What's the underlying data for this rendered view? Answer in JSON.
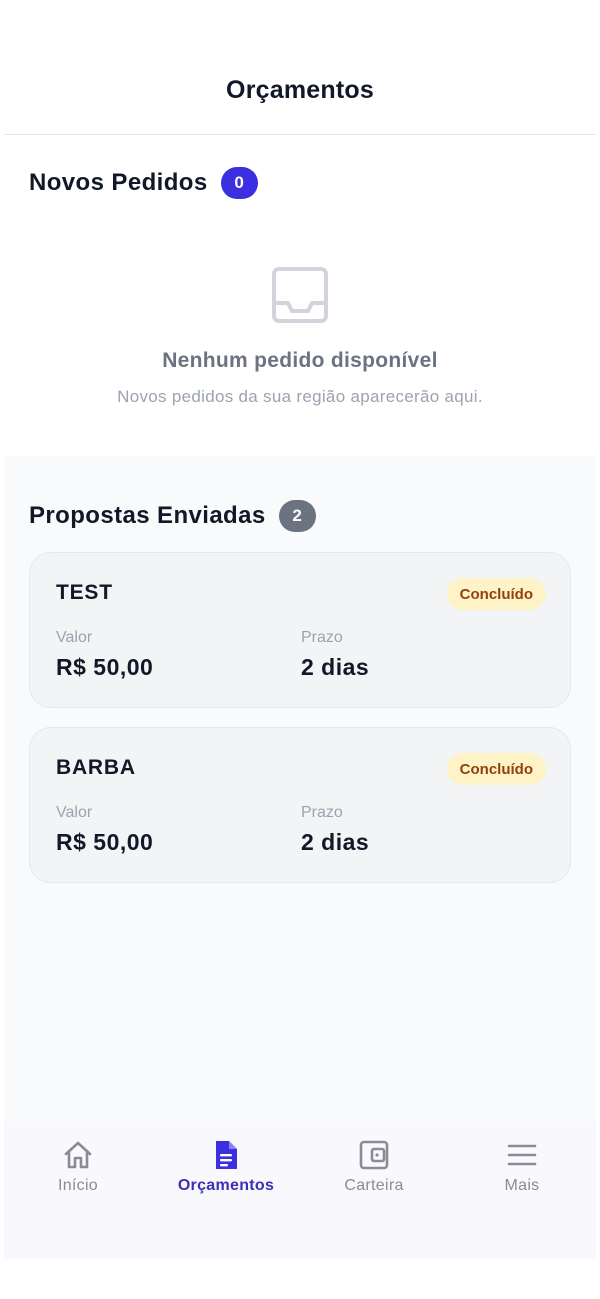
{
  "header": {
    "title": "Orçamentos"
  },
  "new_orders": {
    "title": "Novos Pedidos",
    "count": "0",
    "empty_title": "Nenhum pedido disponível",
    "empty_subtitle": "Novos pedidos da sua região aparecerão aqui.",
    "empty_icon": "inbox-icon"
  },
  "proposals": {
    "title": "Propostas Enviadas",
    "count": "2",
    "items": [
      {
        "name": "TEST",
        "status": "Concluído",
        "value_label": "Valor",
        "value": "R$ 50,00",
        "deadline_label": "Prazo",
        "deadline": "2 dias"
      },
      {
        "name": "BARBA",
        "status": "Concluído",
        "value_label": "Valor",
        "value": "R$ 50,00",
        "deadline_label": "Prazo",
        "deadline": "2 dias"
      }
    ]
  },
  "nav": {
    "items": [
      {
        "label": "Início",
        "icon": "home-icon",
        "active": false
      },
      {
        "label": "Orçamentos",
        "icon": "document-icon",
        "active": true
      },
      {
        "label": "Carteira",
        "icon": "wallet-icon",
        "active": false
      },
      {
        "label": "Mais",
        "icon": "menu-icon",
        "active": false
      }
    ]
  },
  "colors": {
    "accent": "#3b2fe0",
    "status_bg": "#fef3c7",
    "status_text": "#92400e",
    "muted_badge": "#6b7280"
  }
}
